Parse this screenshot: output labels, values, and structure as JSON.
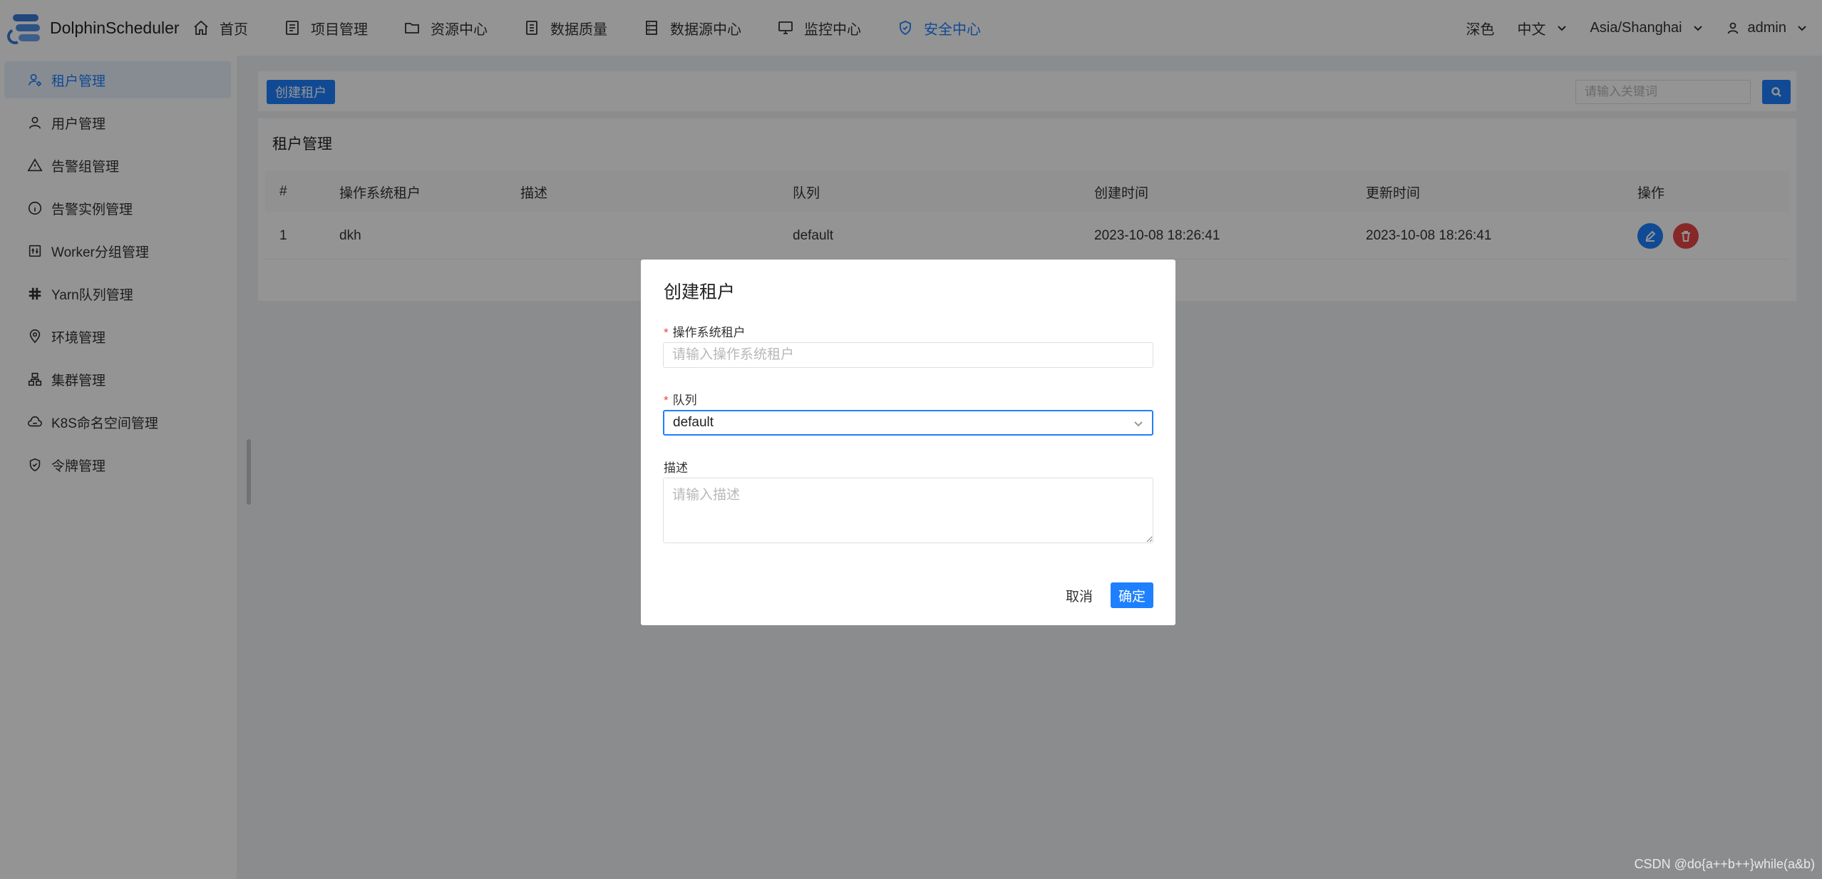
{
  "app": {
    "name": "DolphinScheduler"
  },
  "nav": [
    {
      "label": "首页",
      "icon": "home-icon"
    },
    {
      "label": "项目管理",
      "icon": "project-icon"
    },
    {
      "label": "资源中心",
      "icon": "folder-icon"
    },
    {
      "label": "数据质量",
      "icon": "data-quality-icon"
    },
    {
      "label": "数据源中心",
      "icon": "database-icon"
    },
    {
      "label": "监控中心",
      "icon": "monitor-icon"
    },
    {
      "label": "安全中心",
      "icon": "shield-icon",
      "active": true
    }
  ],
  "topright": {
    "theme": "深色",
    "language": "中文",
    "timezone": "Asia/Shanghai",
    "user": "admin"
  },
  "sidebar": [
    {
      "label": "租户管理",
      "icon": "tenant-icon",
      "active": true
    },
    {
      "label": "用户管理",
      "icon": "user-icon"
    },
    {
      "label": "告警组管理",
      "icon": "warning-icon"
    },
    {
      "label": "告警实例管理",
      "icon": "info-icon"
    },
    {
      "label": "Worker分组管理",
      "icon": "worker-icon"
    },
    {
      "label": "Yarn队列管理",
      "icon": "yarn-icon"
    },
    {
      "label": "环境管理",
      "icon": "location-icon"
    },
    {
      "label": "集群管理",
      "icon": "cluster-icon"
    },
    {
      "label": "K8S命名空间管理",
      "icon": "cloud-icon"
    },
    {
      "label": "令牌管理",
      "icon": "shield-check-icon"
    }
  ],
  "toolbar": {
    "create_label": "创建租户",
    "search_placeholder": "请输入关键词"
  },
  "table": {
    "title": "租户管理",
    "headers": [
      "#",
      "操作系统租户",
      "描述",
      "队列",
      "创建时间",
      "更新时间",
      "操作"
    ],
    "rows": [
      {
        "index": "1",
        "tenant": "dkh",
        "description": "",
        "queue": "default",
        "created": "2023-10-08 18:26:41",
        "updated": "2023-10-08 18:26:41"
      }
    ]
  },
  "modal": {
    "title": "创建租户",
    "tenant_label": "操作系统租户",
    "tenant_placeholder": "请输入操作系统租户",
    "queue_label": "队列",
    "queue_value": "default",
    "desc_label": "描述",
    "desc_placeholder": "请输入描述",
    "required_mark": "*",
    "cancel_label": "取消",
    "ok_label": "确定"
  },
  "watermark": "CSDN @do{a++b++}while(a&b)",
  "colors": {
    "primary": "#1e80ff",
    "danger": "#e84545",
    "overlay": "rgba(0,0,0,0.42)"
  }
}
